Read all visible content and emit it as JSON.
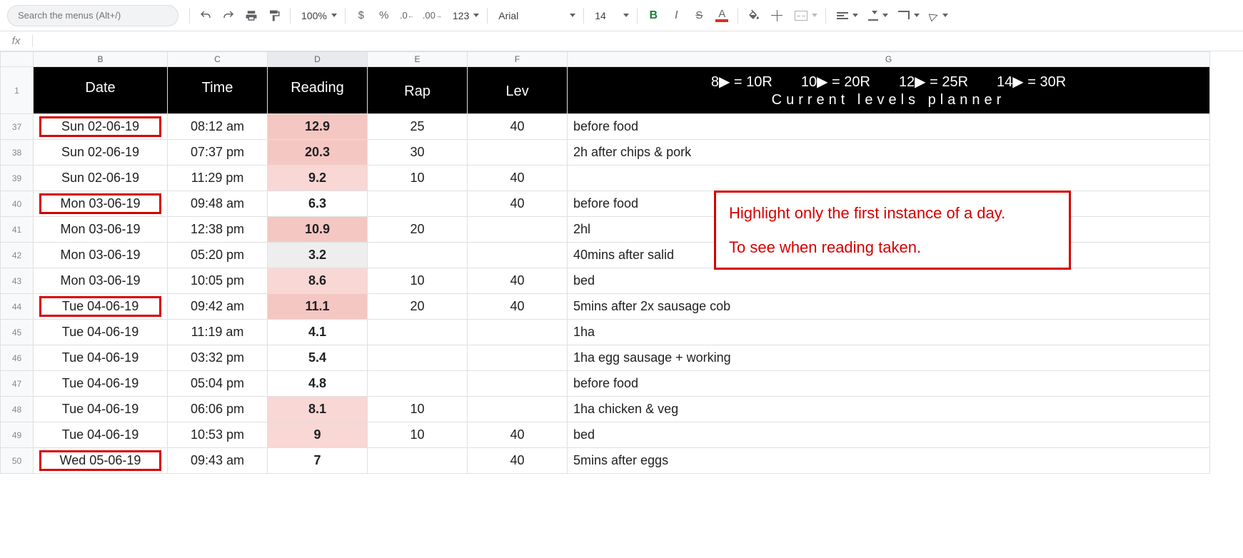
{
  "toolbar": {
    "search_placeholder": "Search the menus (Alt+/)",
    "zoom": "100%",
    "format_123": "123",
    "font": "Arial",
    "font_size": "14"
  },
  "columns": {
    "B": "B",
    "C": "C",
    "D": "D",
    "E": "E",
    "F": "F",
    "G": "G"
  },
  "header": {
    "row_label": "1",
    "date": "Date",
    "time": "Time",
    "reading": "Reading",
    "rap": "Rap",
    "lev": "Lev",
    "rules": [
      "8▶ = 10R",
      "10▶ = 20R",
      "12▶ = 25R",
      "14▶ = 30R"
    ],
    "planner": "Current levels planner"
  },
  "rows": [
    {
      "n": "37",
      "date": "Sun 02-06-19",
      "time": "08:12 am",
      "reading": "12.9",
      "rcls": "r-pink",
      "rap": "25",
      "lev": "40",
      "note": "before food",
      "first": true
    },
    {
      "n": "38",
      "date": "Sun 02-06-19",
      "time": "07:37 pm",
      "reading": "20.3",
      "rcls": "r-pink",
      "rap": "30",
      "lev": "",
      "note": "2h after chips & pork",
      "first": false
    },
    {
      "n": "39",
      "date": "Sun 02-06-19",
      "time": "11:29 pm",
      "reading": "9.2",
      "rcls": "r-lpink",
      "rap": "10",
      "lev": "40",
      "note": "",
      "first": false
    },
    {
      "n": "40",
      "date": "Mon 03-06-19",
      "time": "09:48 am",
      "reading": "6.3",
      "rcls": "r-white",
      "rap": "",
      "lev": "40",
      "note": "before food",
      "first": true
    },
    {
      "n": "41",
      "date": "Mon 03-06-19",
      "time": "12:38 pm",
      "reading": "10.9",
      "rcls": "r-pink",
      "rap": "20",
      "lev": "",
      "note": "2hl",
      "first": false
    },
    {
      "n": "42",
      "date": "Mon 03-06-19",
      "time": "05:20 pm",
      "reading": "3.2",
      "rcls": "r-grey",
      "rap": "",
      "lev": "",
      "note": "40mins after salid",
      "first": false
    },
    {
      "n": "43",
      "date": "Mon 03-06-19",
      "time": "10:05 pm",
      "reading": "8.6",
      "rcls": "r-lpink",
      "rap": "10",
      "lev": "40",
      "note": "bed",
      "first": false
    },
    {
      "n": "44",
      "date": "Tue 04-06-19",
      "time": "09:42 am",
      "reading": "11.1",
      "rcls": "r-pink",
      "rap": "20",
      "lev": "40",
      "note": "5mins after 2x sausage cob",
      "first": true
    },
    {
      "n": "45",
      "date": "Tue 04-06-19",
      "time": "11:19 am",
      "reading": "4.1",
      "rcls": "r-white",
      "rap": "",
      "lev": "",
      "note": "1ha",
      "first": false
    },
    {
      "n": "46",
      "date": "Tue 04-06-19",
      "time": "03:32 pm",
      "reading": "5.4",
      "rcls": "r-white",
      "rap": "",
      "lev": "",
      "note": "1ha egg sausage + working",
      "first": false
    },
    {
      "n": "47",
      "date": "Tue 04-06-19",
      "time": "05:04 pm",
      "reading": "4.8",
      "rcls": "r-white",
      "rap": "",
      "lev": "",
      "note": "before food",
      "first": false
    },
    {
      "n": "48",
      "date": "Tue 04-06-19",
      "time": "06:06 pm",
      "reading": "8.1",
      "rcls": "r-lpink",
      "rap": "10",
      "lev": "",
      "note": "1ha chicken & veg",
      "first": false
    },
    {
      "n": "49",
      "date": "Tue 04-06-19",
      "time": "10:53 pm",
      "reading": "9",
      "rcls": "r-lpink",
      "rap": "10",
      "lev": "40",
      "note": "bed",
      "first": false
    },
    {
      "n": "50",
      "date": "Wed 05-06-19",
      "time": "09:43 am",
      "reading": "7",
      "rcls": "r-white",
      "rap": "",
      "lev": "40",
      "note": "5mins after eggs",
      "first": true
    }
  ],
  "annotation": {
    "line1": "Highlight only the first instance of a day.",
    "line2": "To see when reading taken."
  }
}
